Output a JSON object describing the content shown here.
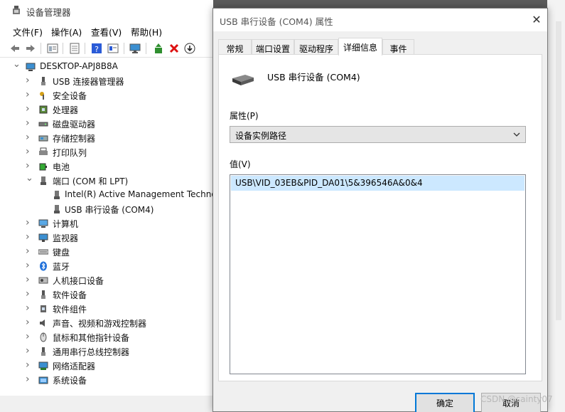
{
  "device_manager": {
    "title": "设备管理器",
    "menu": [
      "文件(F)",
      "操作(A)",
      "查看(V)",
      "帮助(H)"
    ],
    "toolbar_icons": [
      "back-arrow-icon",
      "forward-arrow-icon",
      "properties-grid-icon",
      "document-icon",
      "help-icon",
      "view-icon",
      "monitor-icon",
      "update-driver-icon",
      "uninstall-x-icon",
      "download-icon"
    ],
    "tree": {
      "root": "DESKTOP-APJ8B8A",
      "items": [
        {
          "label": "USB 连接器管理器",
          "icon": "usb-connector-icon",
          "expanded": false
        },
        {
          "label": "安全设备",
          "icon": "key-icon",
          "expanded": false
        },
        {
          "label": "处理器",
          "icon": "cpu-icon",
          "expanded": false
        },
        {
          "label": "磁盘驱动器",
          "icon": "disk-icon",
          "expanded": false
        },
        {
          "label": "存储控制器",
          "icon": "storage-icon",
          "expanded": false
        },
        {
          "label": "打印队列",
          "icon": "printer-icon",
          "expanded": false
        },
        {
          "label": "电池",
          "icon": "battery-icon",
          "expanded": false
        },
        {
          "label": "端口 (COM 和 LPT)",
          "icon": "port-icon",
          "expanded": true,
          "children": [
            "Intel(R) Active Management Technol",
            "USB 串行设备 (COM4)"
          ]
        },
        {
          "label": "计算机",
          "icon": "computer-icon",
          "expanded": false
        },
        {
          "label": "监视器",
          "icon": "monitor-icon",
          "expanded": false
        },
        {
          "label": "键盘",
          "icon": "keyboard-icon",
          "expanded": false
        },
        {
          "label": "蓝牙",
          "icon": "bluetooth-icon",
          "expanded": false
        },
        {
          "label": "人机接口设备",
          "icon": "hid-icon",
          "expanded": false
        },
        {
          "label": "软件设备",
          "icon": "software-device-icon",
          "expanded": false
        },
        {
          "label": "软件组件",
          "icon": "software-component-icon",
          "expanded": false
        },
        {
          "label": "声音、视频和游戏控制器",
          "icon": "speaker-icon",
          "expanded": false
        },
        {
          "label": "鼠标和其他指针设备",
          "icon": "mouse-icon",
          "expanded": false
        },
        {
          "label": "通用串行总线控制器",
          "icon": "usb-icon",
          "expanded": false
        },
        {
          "label": "网络适配器",
          "icon": "network-icon",
          "expanded": false
        },
        {
          "label": "系统设备",
          "icon": "system-folder-icon",
          "expanded": false
        }
      ]
    }
  },
  "dialog": {
    "title": "USB 串行设备 (COM4) 属性",
    "close_glyph": "✕",
    "tabs": [
      "常规",
      "端口设置",
      "驱动程序",
      "详细信息",
      "事件"
    ],
    "active_tab": "详细信息",
    "device_name": "USB 串行设备 (COM4)",
    "property_label": "属性(P)",
    "property_selected": "设备实例路径",
    "value_label": "值(V)",
    "value_items": [
      "USB\\VID_03EB&PID_DA01\\5&396546A&0&4"
    ],
    "ok_label": "确定",
    "cancel_label": "取消"
  },
  "watermark": "CSDN @sainty07",
  "colors": {
    "selection": "#cce8ff",
    "accent": "#0078d7",
    "dialog_bg": "#f0f0f0"
  }
}
